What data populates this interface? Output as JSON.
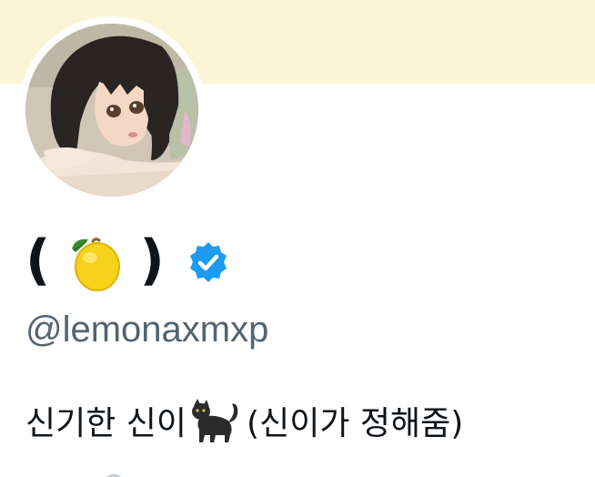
{
  "header": {
    "banner_color": "#fbf5d6"
  },
  "profile": {
    "avatar_icon": "anime-girl-avatar",
    "name_open": "(",
    "name_emoji": "lemon-emoji",
    "name_close": ")",
    "verified_icon": "verified-badge-icon",
    "verified_color": "#1d9bf0",
    "handle": "@lemonaxmxp",
    "bio_before": "신기한 신이",
    "bio_emoji": "black-cat-emoji",
    "bio_after": " (신이가 정해줌)"
  },
  "colors": {
    "text_primary": "#0f1419",
    "text_secondary": "#536471"
  }
}
